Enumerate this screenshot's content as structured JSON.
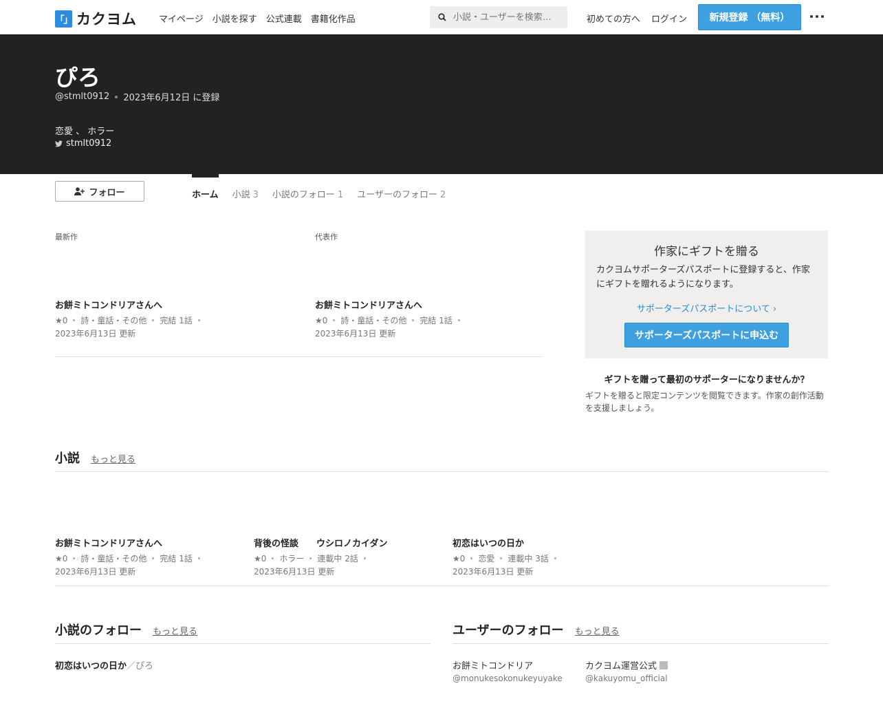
{
  "header": {
    "logo_mark": "「」",
    "logo_text": "カクヨム",
    "nav": [
      "マイページ",
      "小説を探す",
      "公式連載",
      "書籍化作品"
    ],
    "search_placeholder": "小説・ユーザーを検索…",
    "beginners_link": "初めての方へ",
    "login_link": "ログイン",
    "signup_button": "新規登録 （無料）"
  },
  "profile": {
    "name": "ぴろ",
    "handle": "@stmlt0912",
    "registered": "2023年6月12日 に登録",
    "intro": "恋愛 、 ホラー",
    "twitter": "stmlt0912"
  },
  "follow_button": "フォロー",
  "tabs": [
    {
      "label": "ホーム",
      "count": ""
    },
    {
      "label": "小説",
      "count": "3"
    },
    {
      "label": "小説のフォロー",
      "count": "1"
    },
    {
      "label": "ユーザーのフォロー",
      "count": "2"
    }
  ],
  "latest": {
    "label": "最新作",
    "title": "お餅ミトコンドリアさんへ",
    "stars": "★0",
    "genre": "詩・童話・その他",
    "status": "完結 1話",
    "date": "2023年6月13日 更新"
  },
  "featured": {
    "label": "代表作",
    "title": "お餅ミトコンドリアさんへ",
    "stars": "★0",
    "genre": "詩・童話・その他",
    "status": "完結 1話",
    "date": "2023年6月13日 更新"
  },
  "gift": {
    "title": "作家にギフトを贈る",
    "body": "カクヨムサポーターズパスポートに登録すると、作家にギフトを贈れるようになります。",
    "link": "サポーターズパスポートについて ›",
    "button": "サポーターズパスポートに申込む",
    "question": "ギフトを贈って最初のサポーターになりませんか？",
    "description": "ギフトを贈ると限定コンテンツを閲覧できます。作家の創作活動を支援しましょう。"
  },
  "novels": {
    "heading": "小説",
    "more": "もっと見る",
    "items": [
      {
        "title": "お餅ミトコンドリアさんへ",
        "stars": "★0",
        "genre": "詩・童話・その他",
        "status": "完結 1話",
        "date": "2023年6月13日 更新"
      },
      {
        "title": "背後の怪談　　ウシロノカイダン",
        "stars": "★0",
        "genre": "ホラー",
        "status": "連載中 2話",
        "date": "2023年6月13日 更新"
      },
      {
        "title": "初恋はいつの日か",
        "stars": "★0",
        "genre": "恋愛",
        "status": "連載中 3話",
        "date": "2023年6月13日 更新"
      }
    ]
  },
  "followed_novels": {
    "heading": "小説のフォロー",
    "more": "もっと見る",
    "item_title": "初恋はいつの日か",
    "item_author": "／ぴろ"
  },
  "followed_users": {
    "heading": "ユーザーのフォロー",
    "more": "もっと見る",
    "users": [
      {
        "name": "お餅ミトコンドリア",
        "id": "@monukesokonukeyuyake"
      },
      {
        "name": "カクヨム運営公式",
        "id": "@kakuyomu_official"
      }
    ]
  }
}
